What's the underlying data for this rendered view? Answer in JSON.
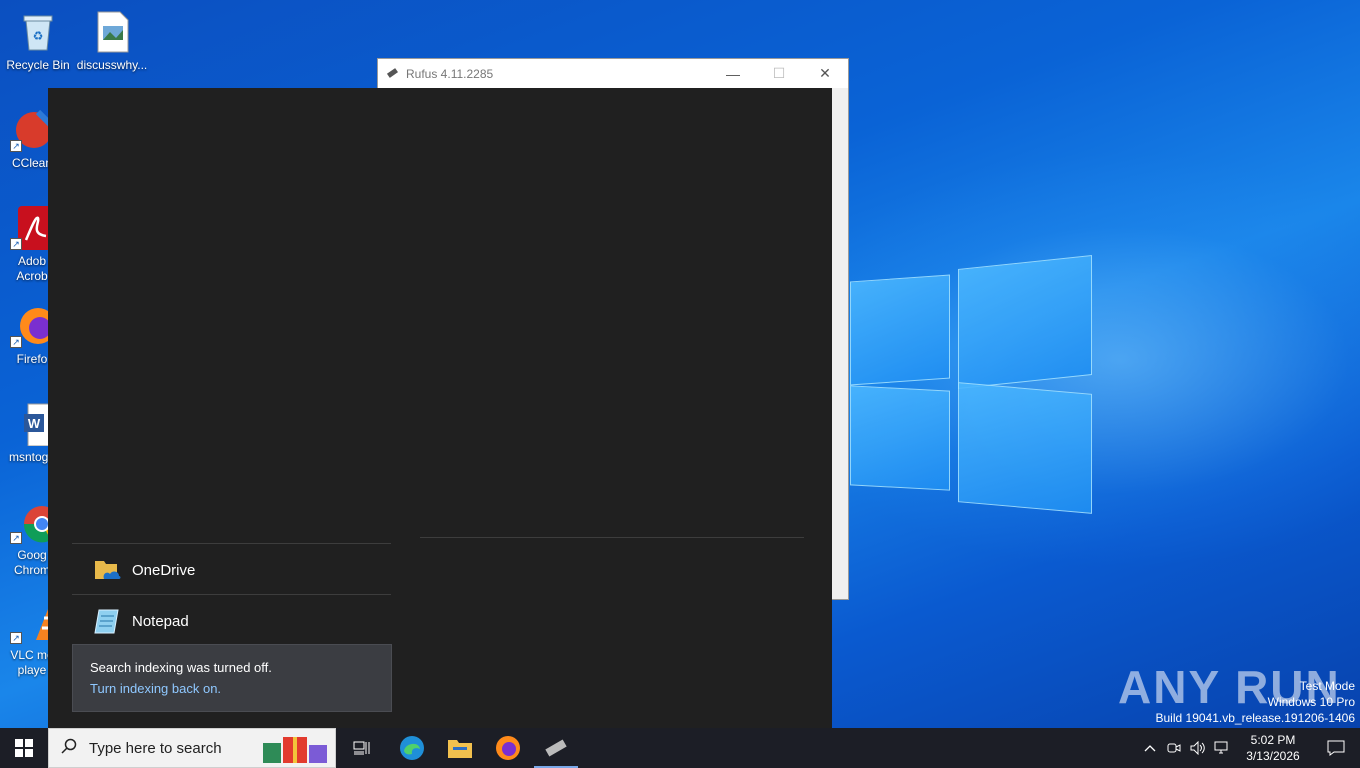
{
  "desktop": {
    "icons": [
      {
        "label": "Recycle Bin"
      },
      {
        "label": "discusswhy..."
      },
      {
        "label": "CClean"
      },
      {
        "label": "Adob\nAcrob"
      },
      {
        "label": "Firefo"
      },
      {
        "label": "msntoge"
      },
      {
        "label": "Goog\nChrom"
      },
      {
        "label": "VLC me\nplaye"
      }
    ]
  },
  "rufus": {
    "title": "Rufus 4.11.2285",
    "minimize": "—",
    "maximize": "☐",
    "close": "✕"
  },
  "search_panel": {
    "results": [
      {
        "label": "OneDrive",
        "icon": "onedrive-icon"
      },
      {
        "label": "Notepad",
        "icon": "notepad-icon"
      }
    ],
    "notice": {
      "message": "Search indexing was turned off.",
      "link": "Turn indexing back on."
    }
  },
  "watermark": {
    "brand": "ANY RUN",
    "line1": "Test Mode",
    "line2": "Windows 10 Pro",
    "line3": "Build 19041.vb_release.191206-1406"
  },
  "taskbar": {
    "search_placeholder": "Type here to search",
    "time": "5:02 PM",
    "date": "3/13/2026",
    "pinned": [
      "task-view-icon",
      "edge-icon",
      "file-explorer-icon",
      "firefox-icon",
      "rufus-icon"
    ]
  },
  "colors": {
    "panel_bg": "#202020",
    "taskbar_bg": "#1c1e26",
    "link": "#8fc8ff",
    "accent": "#0a63d6"
  }
}
